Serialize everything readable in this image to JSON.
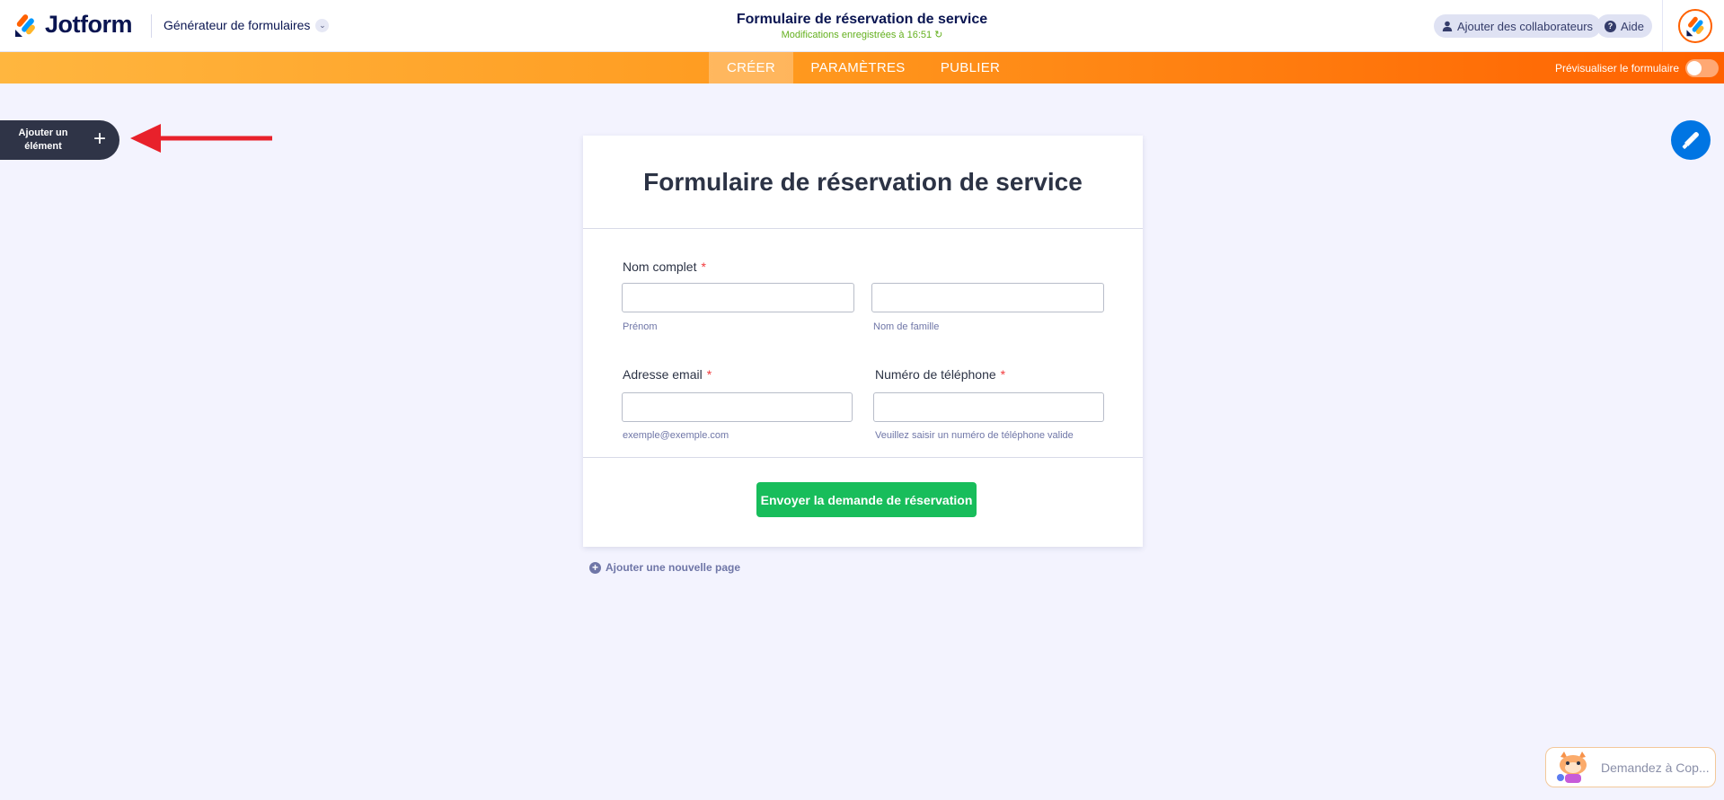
{
  "header": {
    "logo_text": "Jotform",
    "builder_menu": "Générateur de formulaires",
    "form_title": "Formulaire de réservation de service",
    "saved_status": "Modifications enregistrées à 16:51 ↻",
    "collaborators_label": "Ajouter des collaborateurs",
    "help_label": "Aide"
  },
  "nav": {
    "tabs": [
      {
        "label": "CRÉER",
        "active": true
      },
      {
        "label": "PARAMÈTRES",
        "active": false
      },
      {
        "label": "PUBLIER",
        "active": false
      }
    ],
    "preview_label": "Prévisualiser le formulaire",
    "preview_on": false
  },
  "add_element": {
    "label": "Ajouter un élément",
    "plus": "+"
  },
  "form": {
    "title": "Formulaire de réservation de service",
    "fields": {
      "full_name": {
        "label": "Nom complet",
        "required": "*",
        "first_sublabel": "Prénom",
        "last_sublabel": "Nom de famille",
        "first_value": "",
        "last_value": ""
      },
      "email": {
        "label": "Adresse email",
        "required": "*",
        "sublabel": "exemple@exemple.com",
        "value": ""
      },
      "phone": {
        "label": "Numéro de téléphone",
        "required": "*",
        "sublabel": "Veuillez saisir un numéro de téléphone valide",
        "value": ""
      }
    },
    "submit_label": "Envoyer la demande de réservation"
  },
  "add_page_label": "Ajouter une nouvelle page",
  "copilot": {
    "label": "Demandez à Cop..."
  },
  "colors": {
    "brand_orange": "#ff6100",
    "brand_navy": "#0a1551",
    "submit_green": "#18bd5b",
    "designer_blue": "#0075e3",
    "annotation_red": "#e8212b"
  }
}
